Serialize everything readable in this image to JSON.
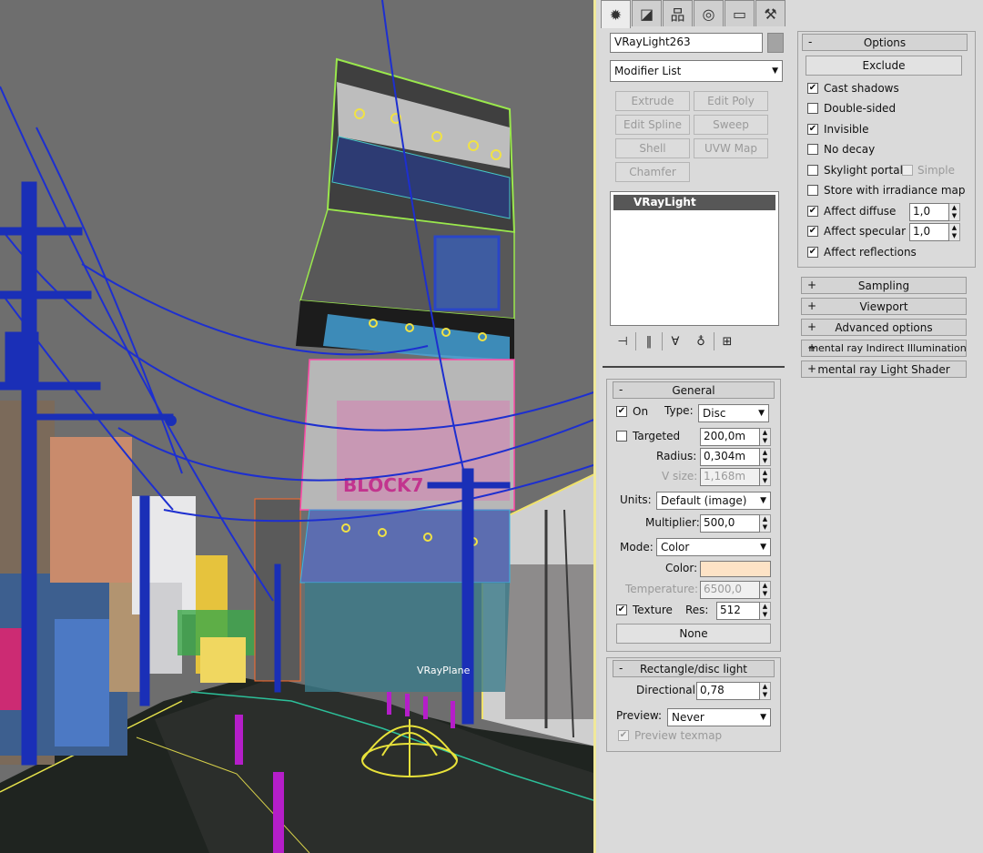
{
  "viewport": {
    "object_label": "VRayPlane",
    "building_sign": "BLOCK7"
  },
  "tabs": [
    {
      "name": "create-tab-icon",
      "glyph": "✹"
    },
    {
      "name": "modify-tab-icon",
      "glyph": "◪"
    },
    {
      "name": "hierarchy-tab-icon",
      "glyph": "品"
    },
    {
      "name": "motion-tab-icon",
      "glyph": "◎"
    },
    {
      "name": "display-tab-icon",
      "glyph": "▭"
    },
    {
      "name": "utilities-tab-icon",
      "glyph": "⚒"
    }
  ],
  "object": {
    "name": "VRayLight263"
  },
  "modifier_list": {
    "selected": "Modifier List"
  },
  "modifier_buttons": [
    "Extrude",
    "Edit Poly",
    "Edit Spline",
    "Sweep",
    "Shell",
    "UVW Map",
    "Chamfer"
  ],
  "stack": {
    "selected_item": "VRayLight"
  },
  "general": {
    "title": "General",
    "collapse_sign": "-",
    "on_label": "On",
    "type_label": "Type:",
    "type_value": "Disc",
    "targeted_label": "Targeted",
    "targeted_value": "200,0m",
    "radius_label": "Radius:",
    "radius_value": "0,304m",
    "vsize_label": "V size:",
    "vsize_value": "1,168m",
    "units_label": "Units:",
    "units_value": "Default (image)",
    "multiplier_label": "Multiplier:",
    "multiplier_value": "500,0",
    "mode_label": "Mode:",
    "mode_value": "Color",
    "color_label": "Color:",
    "color_hex": "#fde3c6",
    "temperature_label": "Temperature:",
    "temperature_value": "6500,0",
    "texture_label": "Texture",
    "res_label": "Res:",
    "res_value": "512",
    "texture_button": "None"
  },
  "rect_disc": {
    "title": "Rectangle/disc light",
    "collapse_sign": "-",
    "directional_label": "Directional:",
    "directional_value": "0,78",
    "preview_label": "Preview:",
    "preview_value": "Never",
    "preview_texmap_label": "Preview texmap"
  },
  "options": {
    "title": "Options",
    "collapse_sign": "-",
    "exclude_button": "Exclude",
    "cast_shadows": "Cast shadows",
    "double_sided": "Double-sided",
    "invisible": "Invisible",
    "no_decay": "No decay",
    "skylight_portal": "Skylight portal",
    "simple": "Simple",
    "store_irradiance": "Store with irradiance map",
    "affect_diffuse": "Affect diffuse",
    "affect_diffuse_value": "1,0",
    "affect_specular": "Affect specular",
    "affect_specular_value": "1,0",
    "affect_reflections": "Affect reflections"
  },
  "collapsed_rollouts": [
    {
      "sign": "+",
      "title": "Sampling"
    },
    {
      "sign": "+",
      "title": "Viewport"
    },
    {
      "sign": "+",
      "title": "Advanced options"
    },
    {
      "sign": "+",
      "title": "mental ray Indirect Illumination"
    },
    {
      "sign": "+",
      "title": "mental ray Light Shader"
    }
  ],
  "check_mark": "✔",
  "spin_up": "▲",
  "spin_down": "▼",
  "dropdown_arrow": "▼"
}
